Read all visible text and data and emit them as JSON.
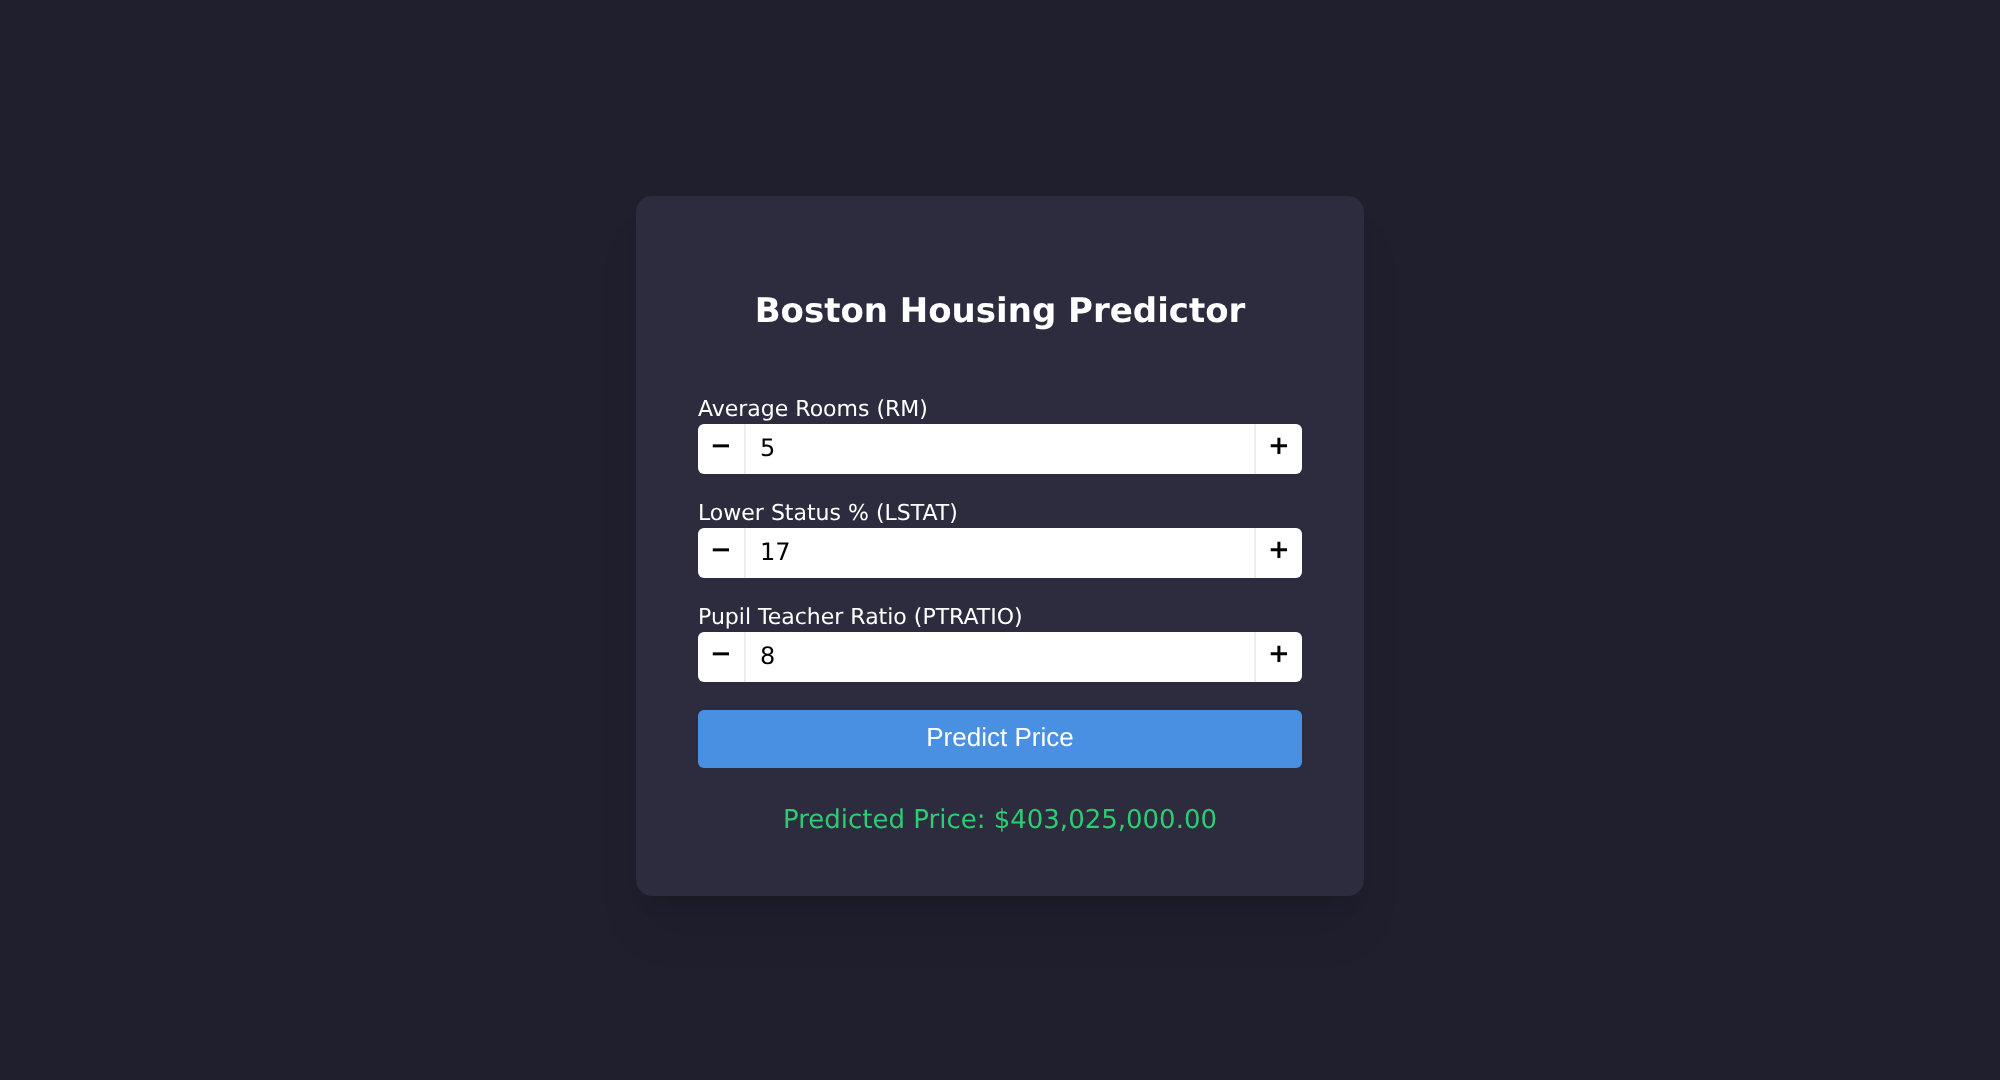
{
  "title": "Boston Housing Predictor",
  "fields": [
    {
      "label": "Average Rooms (RM)",
      "value": "5",
      "decrement": "−",
      "increment": "+"
    },
    {
      "label": "Lower Status % (LSTAT)",
      "value": "17",
      "decrement": "−",
      "increment": "+"
    },
    {
      "label": "Pupil Teacher Ratio (PTRATIO)",
      "value": "8",
      "decrement": "−",
      "increment": "+"
    }
  ],
  "button": "Predict Price",
  "result": "Predicted Price: $403,025,000.00"
}
